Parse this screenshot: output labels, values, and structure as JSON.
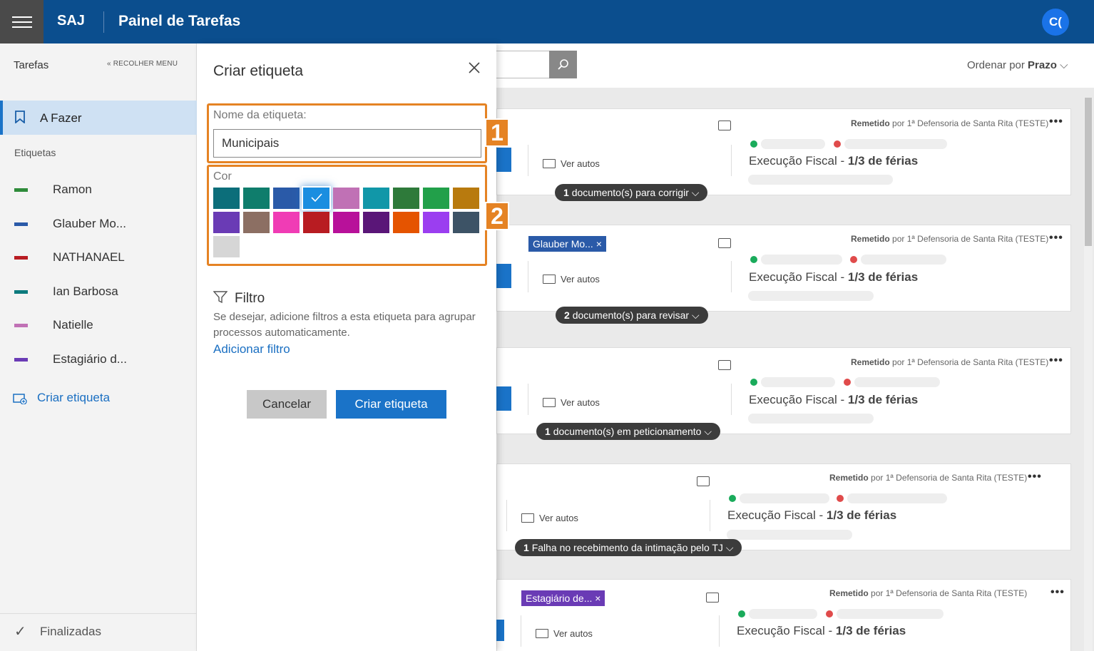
{
  "header": {
    "brand": "SAJ",
    "title": "Painel de Tarefas",
    "avatar_initials": "C("
  },
  "sidebar": {
    "title": "Tarefas",
    "collapse_label": "RECOLHER MENU",
    "active_item": "A Fazer",
    "section_label": "Etiquetas",
    "tags": [
      {
        "label": "Ramon",
        "color": "#2e8b3a"
      },
      {
        "label": "Glauber Mo...",
        "color": "#2a5aa8"
      },
      {
        "label": "NATHANAEL",
        "color": "#b81c22"
      },
      {
        "label": "Ian Barbosa",
        "color": "#0c7a7d"
      },
      {
        "label": "Natielle",
        "color": "#c071b5"
      },
      {
        "label": "Estagiário d...",
        "color": "#6a3bb5"
      }
    ],
    "create_label": "Criar etiqueta",
    "finished_label": "Finalizadas"
  },
  "toolbar": {
    "sort_prefix": "Ordenar por",
    "sort_value": "Prazo"
  },
  "cards": [
    {
      "remetido": "Remetido",
      "by": "por 1ª Defensoria de Santa Rita (TESTE)",
      "ver_autos": "Ver autos",
      "exec": "Execução Fiscal",
      "exec_bold": "1/3 de férias",
      "pill_count": "1",
      "pill_text": "documento(s) para corrigir",
      "tag": ""
    },
    {
      "remetido": "Remetido",
      "by": "por 1ª Defensoria de Santa Rita (TESTE)",
      "ver_autos": "Ver autos",
      "exec": "Execução Fiscal",
      "exec_bold": "1/3 de férias",
      "pill_count": "2",
      "pill_text": "documento(s) para revisar",
      "tag": "Glauber Mo..."
    },
    {
      "remetido": "Remetido",
      "by": "por 1ª Defensoria de Santa Rita (TESTE)",
      "ver_autos": "Ver autos",
      "exec": "Execução Fiscal",
      "exec_bold": "1/3 de férias",
      "pill_count": "1",
      "pill_text": "documento(s) em peticionamento",
      "tag": ""
    },
    {
      "remetido": "Remetido",
      "by": "por 1ª Defensoria de Santa Rita (TESTE)",
      "ver_autos": "Ver autos",
      "exec": "Execução Fiscal",
      "exec_bold": "1/3 de férias",
      "pill_count": "1",
      "pill_text": "Falha no recebimento da intimação pelo TJ",
      "tag": ""
    },
    {
      "remetido": "Remetido",
      "by": "por 1ª Defensoria de Santa Rita (TESTE)",
      "ver_autos": "Ver autos",
      "exec": "Execução Fiscal",
      "exec_bold": "1/3 de férias",
      "pill_count": "",
      "pill_text": "",
      "tag": "Estagiário de..."
    }
  ],
  "dialog": {
    "title": "Criar etiqueta",
    "name_label": "Nome da etiqueta:",
    "name_value": "Municipais",
    "color_label": "Cor",
    "colors": [
      "#0c6e7a",
      "#0f7d6c",
      "#2a5aa8",
      "#1a8ee0",
      "#c071b5",
      "#1197a8",
      "#2e7a3a",
      "#22a04a",
      "#b87a0e",
      "#6a3bb5",
      "#8c6f63",
      "#f03cb5",
      "#b81c22",
      "#b8119a",
      "#5a1678",
      "#e55400",
      "#9b3ef0",
      "#3d5366",
      "#d6d6d6"
    ],
    "selected_color": "#1a8ee0",
    "filter_title": "Filtro",
    "filter_desc": "Se desejar, adicione filtros a esta etiqueta para agrupar processos automaticamente.",
    "add_filter": "Adicionar filtro",
    "cancel": "Cancelar",
    "create": "Criar etiqueta"
  },
  "callouts": {
    "one": "1",
    "two": "2"
  }
}
